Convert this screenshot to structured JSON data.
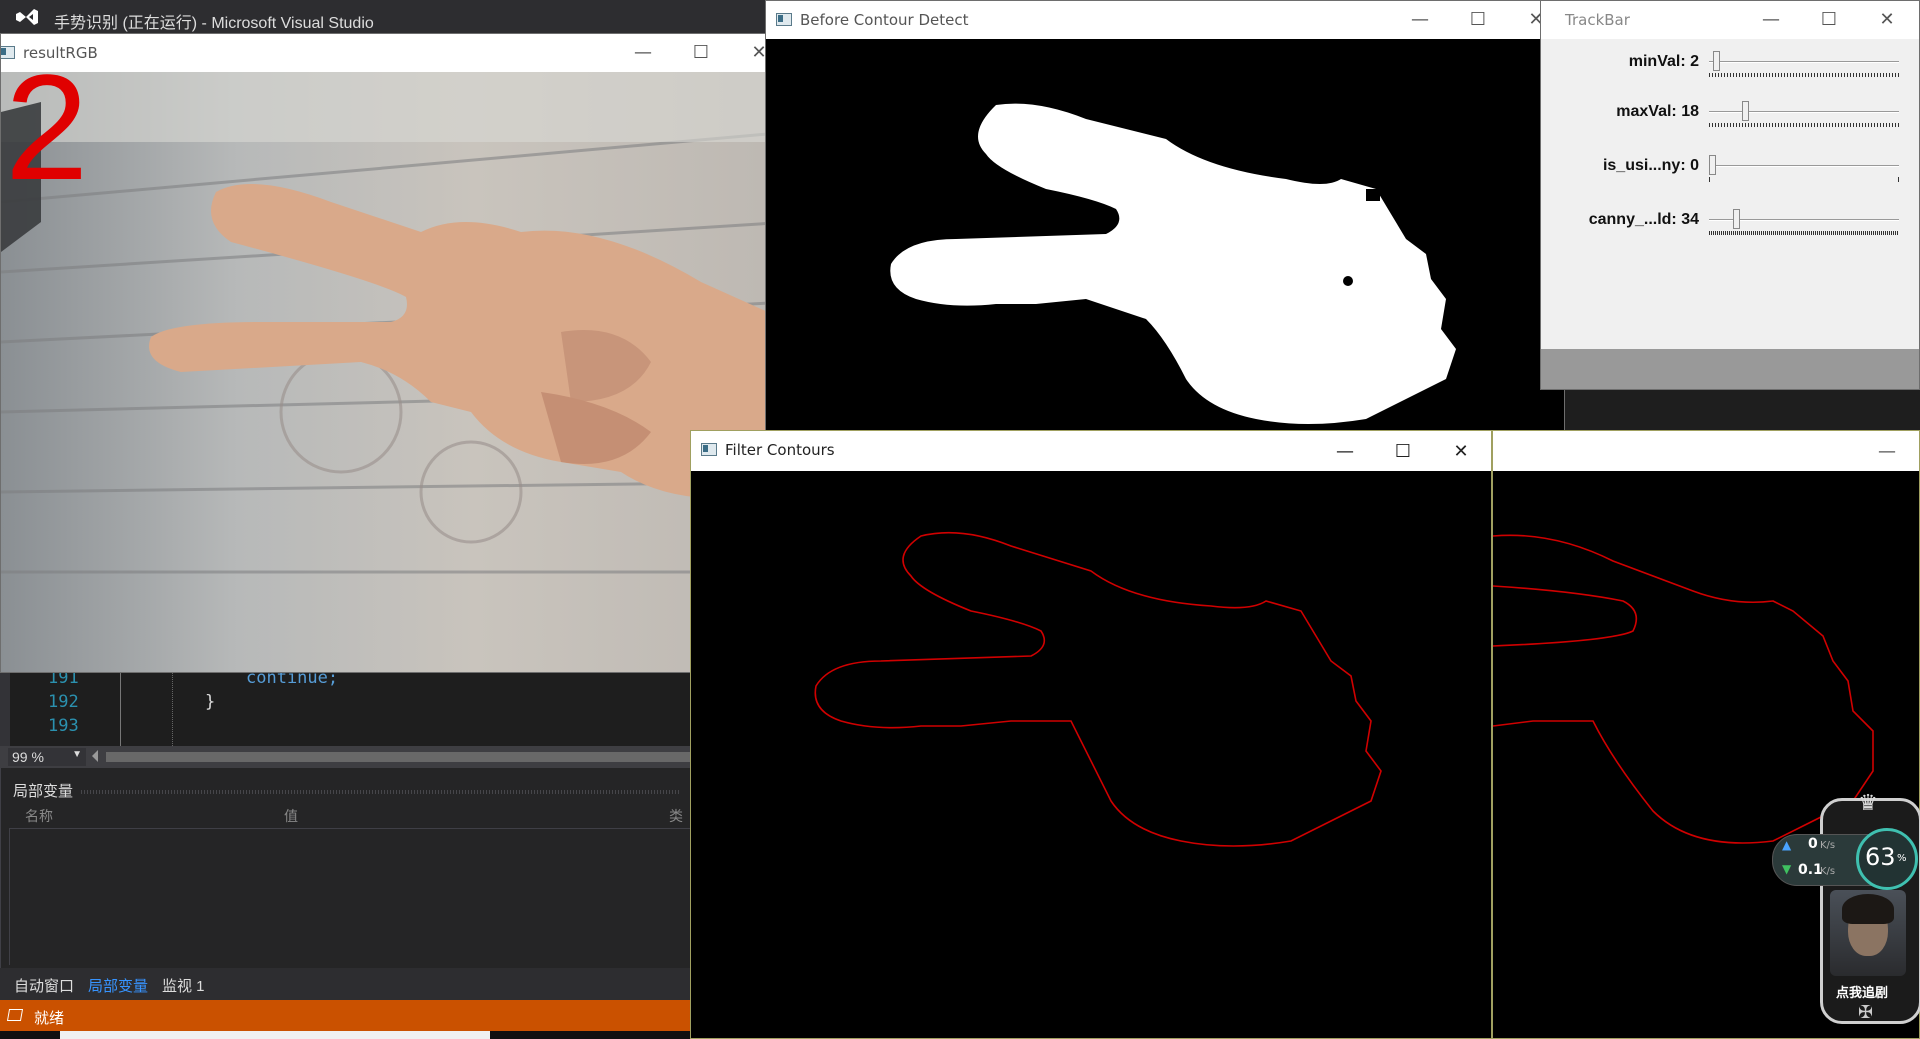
{
  "vs": {
    "title": "手势识别 (正在运行) - Microsoft Visual Studio",
    "code_lines": [
      {
        "num": "191",
        "code": "continue;"
      },
      {
        "num": "192",
        "code": "}"
      },
      {
        "num": "193",
        "code": ""
      }
    ],
    "zoom": "99 %",
    "locals_panel_title": "局部变量",
    "col_name": "名称",
    "col_value": "值",
    "col_type": "类型",
    "tabs": [
      "自动窗口",
      "局部变量",
      "监视 1"
    ],
    "status": "就绪",
    "colors": {
      "status_bar": "#ca5100",
      "accent": "#3794ff"
    }
  },
  "result_rgb": {
    "title": "resultRGB",
    "overlay_number": "2"
  },
  "before_contour": {
    "title": "Before Contour Detect"
  },
  "trackbar": {
    "title": "TrackBar",
    "sliders": [
      {
        "label": "minVal: 2",
        "value": 2,
        "max": 100
      },
      {
        "label": "maxVal: 18",
        "value": 18,
        "max": 100
      },
      {
        "label": "is_usi...ny: 0",
        "value": 0,
        "max": 1
      },
      {
        "label": "canny_...ld: 34",
        "value": 34,
        "max": 255
      }
    ]
  },
  "filter_contours": {
    "title": "Filter Contours",
    "contour_color": "#d00000"
  },
  "net_widget": {
    "upload": "0",
    "upload_unit": "K/s",
    "download": "0.1",
    "download_unit": "K/s",
    "percent": "63",
    "percent_unit": "%",
    "ad_text": "点我追剧"
  },
  "icons": {
    "minimize": "minimize-icon",
    "maximize": "maximize-icon",
    "close": "close-icon",
    "window": "window-icon"
  }
}
